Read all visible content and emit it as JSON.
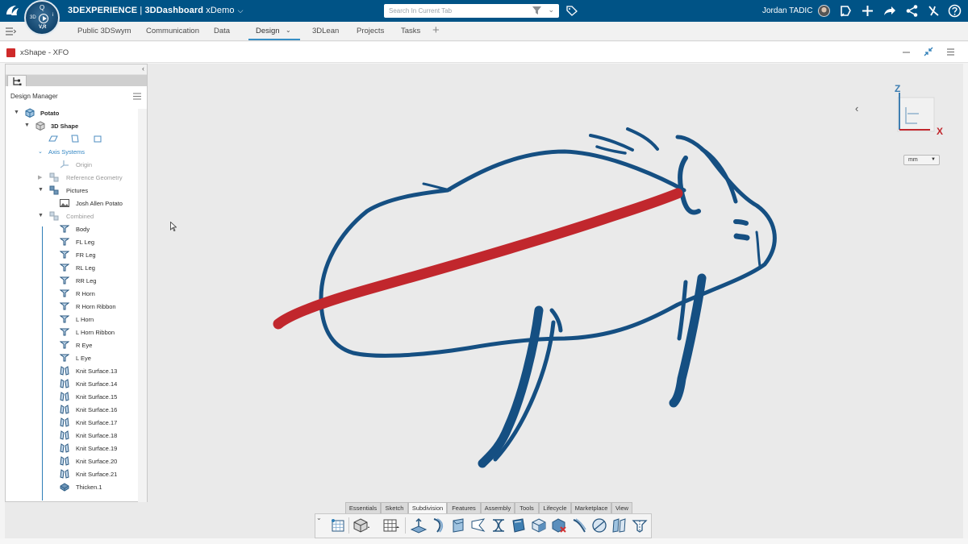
{
  "header": {
    "brand_bold": "3DEXPERIENCE",
    "brand_sep": " | ",
    "brand_app": "3DDashboard",
    "brand_context": "xDemo",
    "search_placeholder": "Search In Current Tab",
    "user_name": "Jordan TADIC"
  },
  "compass": {
    "label_3d": "3D",
    "label_vr": "V,R",
    "label_i": "i",
    "label_q": "Q"
  },
  "tabs": [
    {
      "label": "Public 3DSwym"
    },
    {
      "label": "Communication"
    },
    {
      "label": "Data"
    },
    {
      "label": "Design"
    },
    {
      "label": "3DLean"
    },
    {
      "label": "Projects"
    },
    {
      "label": "Tasks"
    }
  ],
  "active_tab": "Design",
  "app": {
    "title": "xShape - XFO"
  },
  "panel": {
    "title": "Design Manager",
    "tree": [
      {
        "label": "Potato",
        "state": "expanded"
      },
      {
        "label": "3D Shape",
        "state": "expanded"
      },
      {
        "label": "Axis Systems",
        "state": "expanded"
      },
      {
        "label": "Origin"
      },
      {
        "label": "Reference Geometry",
        "state": "collapsed"
      },
      {
        "label": "Pictures",
        "state": "expanded"
      },
      {
        "label": "Josh Allen Potato"
      },
      {
        "label": "Combined",
        "state": "expanded"
      },
      {
        "label": "Body"
      },
      {
        "label": "FL Leg"
      },
      {
        "label": "FR Leg"
      },
      {
        "label": "RL Leg"
      },
      {
        "label": "RR Leg"
      },
      {
        "label": "R Horn"
      },
      {
        "label": "R Horn Ribbon"
      },
      {
        "label": "L Horn"
      },
      {
        "label": "L Horn Ribbon"
      },
      {
        "label": "R Eye"
      },
      {
        "label": "L Eye"
      },
      {
        "label": "Knit Surface.13"
      },
      {
        "label": "Knit Surface.14"
      },
      {
        "label": "Knit Surface.15"
      },
      {
        "label": "Knit Surface.16"
      },
      {
        "label": "Knit Surface.17"
      },
      {
        "label": "Knit Surface.18"
      },
      {
        "label": "Knit Surface.19"
      },
      {
        "label": "Knit Surface.20"
      },
      {
        "label": "Knit Surface.21"
      },
      {
        "label": "Thicken.1"
      }
    ]
  },
  "viewport": {
    "axis_z": "Z",
    "axis_x": "X",
    "unit": "mm",
    "sketch_colors": {
      "outline": "#154f82",
      "accent": "#c1272d"
    }
  },
  "action_bar": {
    "sections": [
      {
        "label": "Essentials"
      },
      {
        "label": "Sketch"
      },
      {
        "label": "Subdivision"
      },
      {
        "label": "Features"
      },
      {
        "label": "Assembly"
      },
      {
        "label": "Tools"
      },
      {
        "label": "Lifecycle"
      },
      {
        "label": "Marketplace"
      },
      {
        "label": "View"
      }
    ],
    "active_section": "Subdivision"
  }
}
